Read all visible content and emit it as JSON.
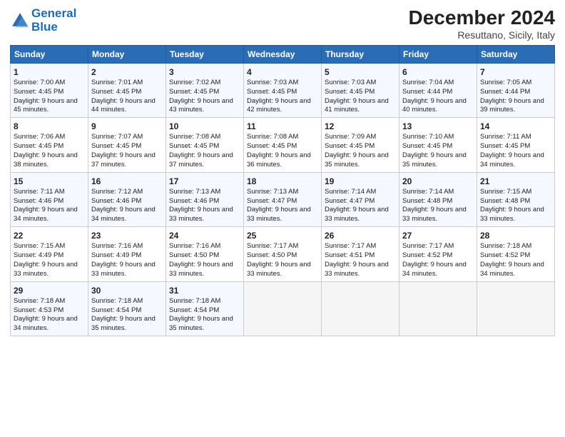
{
  "header": {
    "logo_line1": "General",
    "logo_line2": "Blue",
    "title": "December 2024",
    "subtitle": "Resuttano, Sicily, Italy"
  },
  "days_of_week": [
    "Sunday",
    "Monday",
    "Tuesday",
    "Wednesday",
    "Thursday",
    "Friday",
    "Saturday"
  ],
  "weeks": [
    [
      {
        "day": 1,
        "sunrise": "7:00 AM",
        "sunset": "4:45 PM",
        "daylight": "9 hours and 45 minutes."
      },
      {
        "day": 2,
        "sunrise": "7:01 AM",
        "sunset": "4:45 PM",
        "daylight": "9 hours and 44 minutes."
      },
      {
        "day": 3,
        "sunrise": "7:02 AM",
        "sunset": "4:45 PM",
        "daylight": "9 hours and 43 minutes."
      },
      {
        "day": 4,
        "sunrise": "7:03 AM",
        "sunset": "4:45 PM",
        "daylight": "9 hours and 42 minutes."
      },
      {
        "day": 5,
        "sunrise": "7:03 AM",
        "sunset": "4:45 PM",
        "daylight": "9 hours and 41 minutes."
      },
      {
        "day": 6,
        "sunrise": "7:04 AM",
        "sunset": "4:44 PM",
        "daylight": "9 hours and 40 minutes."
      },
      {
        "day": 7,
        "sunrise": "7:05 AM",
        "sunset": "4:44 PM",
        "daylight": "9 hours and 39 minutes."
      }
    ],
    [
      {
        "day": 8,
        "sunrise": "7:06 AM",
        "sunset": "4:45 PM",
        "daylight": "9 hours and 38 minutes."
      },
      {
        "day": 9,
        "sunrise": "7:07 AM",
        "sunset": "4:45 PM",
        "daylight": "9 hours and 37 minutes."
      },
      {
        "day": 10,
        "sunrise": "7:08 AM",
        "sunset": "4:45 PM",
        "daylight": "9 hours and 37 minutes."
      },
      {
        "day": 11,
        "sunrise": "7:08 AM",
        "sunset": "4:45 PM",
        "daylight": "9 hours and 36 minutes."
      },
      {
        "day": 12,
        "sunrise": "7:09 AM",
        "sunset": "4:45 PM",
        "daylight": "9 hours and 35 minutes."
      },
      {
        "day": 13,
        "sunrise": "7:10 AM",
        "sunset": "4:45 PM",
        "daylight": "9 hours and 35 minutes."
      },
      {
        "day": 14,
        "sunrise": "7:11 AM",
        "sunset": "4:45 PM",
        "daylight": "9 hours and 34 minutes."
      }
    ],
    [
      {
        "day": 15,
        "sunrise": "7:11 AM",
        "sunset": "4:46 PM",
        "daylight": "9 hours and 34 minutes."
      },
      {
        "day": 16,
        "sunrise": "7:12 AM",
        "sunset": "4:46 PM",
        "daylight": "9 hours and 34 minutes."
      },
      {
        "day": 17,
        "sunrise": "7:13 AM",
        "sunset": "4:46 PM",
        "daylight": "9 hours and 33 minutes."
      },
      {
        "day": 18,
        "sunrise": "7:13 AM",
        "sunset": "4:47 PM",
        "daylight": "9 hours and 33 minutes."
      },
      {
        "day": 19,
        "sunrise": "7:14 AM",
        "sunset": "4:47 PM",
        "daylight": "9 hours and 33 minutes."
      },
      {
        "day": 20,
        "sunrise": "7:14 AM",
        "sunset": "4:48 PM",
        "daylight": "9 hours and 33 minutes."
      },
      {
        "day": 21,
        "sunrise": "7:15 AM",
        "sunset": "4:48 PM",
        "daylight": "9 hours and 33 minutes."
      }
    ],
    [
      {
        "day": 22,
        "sunrise": "7:15 AM",
        "sunset": "4:49 PM",
        "daylight": "9 hours and 33 minutes."
      },
      {
        "day": 23,
        "sunrise": "7:16 AM",
        "sunset": "4:49 PM",
        "daylight": "9 hours and 33 minutes."
      },
      {
        "day": 24,
        "sunrise": "7:16 AM",
        "sunset": "4:50 PM",
        "daylight": "9 hours and 33 minutes."
      },
      {
        "day": 25,
        "sunrise": "7:17 AM",
        "sunset": "4:50 PM",
        "daylight": "9 hours and 33 minutes."
      },
      {
        "day": 26,
        "sunrise": "7:17 AM",
        "sunset": "4:51 PM",
        "daylight": "9 hours and 33 minutes."
      },
      {
        "day": 27,
        "sunrise": "7:17 AM",
        "sunset": "4:52 PM",
        "daylight": "9 hours and 34 minutes."
      },
      {
        "day": 28,
        "sunrise": "7:18 AM",
        "sunset": "4:52 PM",
        "daylight": "9 hours and 34 minutes."
      }
    ],
    [
      {
        "day": 29,
        "sunrise": "7:18 AM",
        "sunset": "4:53 PM",
        "daylight": "9 hours and 34 minutes."
      },
      {
        "day": 30,
        "sunrise": "7:18 AM",
        "sunset": "4:54 PM",
        "daylight": "9 hours and 35 minutes."
      },
      {
        "day": 31,
        "sunrise": "7:18 AM",
        "sunset": "4:54 PM",
        "daylight": "9 hours and 35 minutes."
      },
      null,
      null,
      null,
      null
    ]
  ]
}
